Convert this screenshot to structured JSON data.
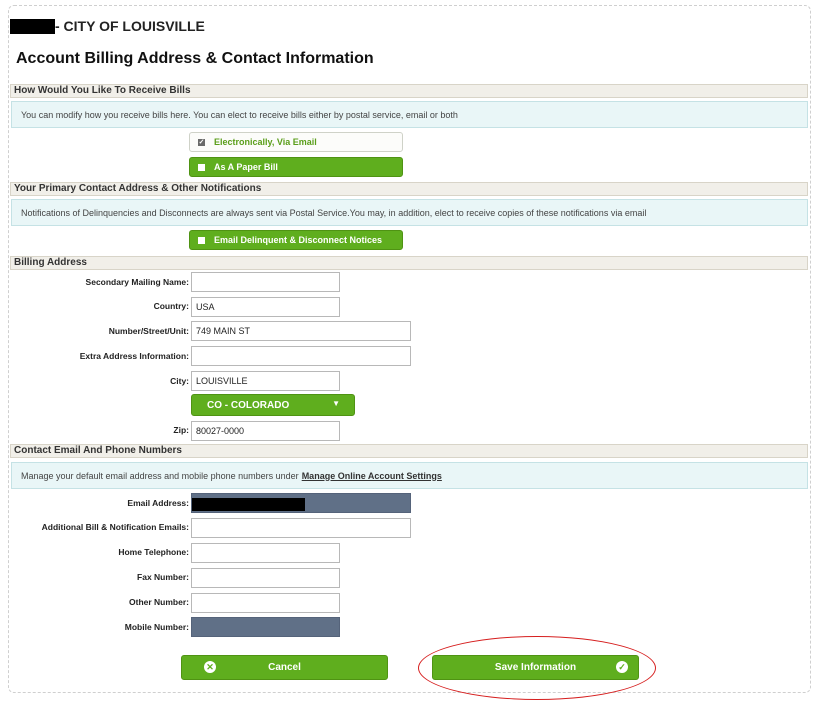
{
  "header": {
    "city_label": "- CITY OF LOUISVILLE",
    "title": "Account Billing Address & Contact Information"
  },
  "receive_bills": {
    "section_title": "How Would You Like To Receive Bills",
    "info": "You can modify how you receive bills here. You can elect to receive bills either by postal service, email or both",
    "options": [
      {
        "label": "Electronically, Via Email",
        "checked": true
      },
      {
        "label": "As A Paper Bill",
        "checked": false
      }
    ]
  },
  "notifications": {
    "section_title": "Your Primary Contact Address & Other Notifications",
    "info": "Notifications of Delinquencies and Disconnects are always sent via Postal Service.You may, in addition, elect to receive copies of these notifications via email",
    "option": {
      "label": "Email Delinquent & Disconnect Notices",
      "checked": false
    }
  },
  "billing": {
    "section_title": "Billing Address",
    "fields": {
      "secondary_name": {
        "label": "Secondary Mailing Name:",
        "value": ""
      },
      "country": {
        "label": "Country:",
        "value": "USA"
      },
      "street": {
        "label": "Number/Street/Unit:",
        "value": "749 MAIN ST"
      },
      "extra": {
        "label": "Extra Address Information:",
        "value": ""
      },
      "city": {
        "label": "City:",
        "value": "LOUISVILLE"
      },
      "zip": {
        "label": "Zip:",
        "value": "80027-0000"
      }
    },
    "state": {
      "selected": "CO - COLORADO"
    }
  },
  "contact": {
    "section_title": "Contact Email And Phone Numbers",
    "info_prefix": "Manage your default email address and mobile phone numbers under",
    "info_link": "Manage Online Account Settings",
    "fields": {
      "email": {
        "label": "Email Address:",
        "value": ""
      },
      "additional": {
        "label": "Additional Bill & Notification Emails:",
        "value": ""
      },
      "home": {
        "label": "Home Telephone:",
        "value": ""
      },
      "fax": {
        "label": "Fax Number:",
        "value": ""
      },
      "other": {
        "label": "Other Number:",
        "value": ""
      },
      "mobile": {
        "label": "Mobile Number:",
        "value": ""
      }
    }
  },
  "actions": {
    "cancel_label": "Cancel",
    "save_label": "Save Information"
  },
  "colors": {
    "accent_green": "#5fae1e",
    "annotation_red": "#d61f1f",
    "section_bg": "#f1efe9",
    "info_bg": "#e9f6f7"
  }
}
